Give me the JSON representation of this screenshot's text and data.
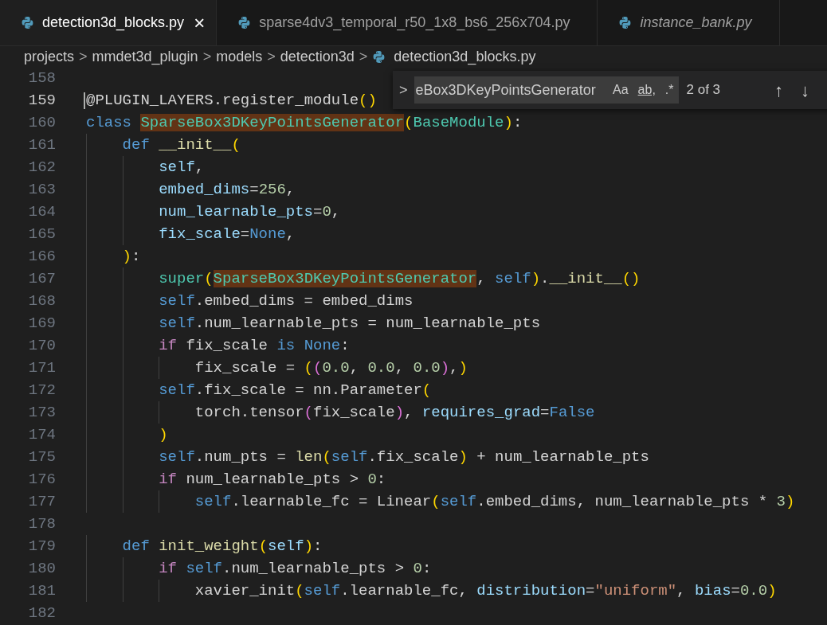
{
  "tabs": [
    {
      "label": "detection3d_blocks.py",
      "selected": true,
      "preview": false,
      "close": "×"
    },
    {
      "label": "sparse4dv3_temporal_r50_1x8_bs6_256x704.py",
      "selected": false,
      "preview": false
    },
    {
      "label": "instance_bank.py",
      "selected": false,
      "preview": true
    }
  ],
  "breadcrumb": [
    {
      "label": "projects",
      "kind": "folder"
    },
    {
      "label": "mmdet3d_plugin",
      "kind": "folder"
    },
    {
      "label": "models",
      "kind": "folder"
    },
    {
      "label": "detection3d",
      "kind": "folder"
    },
    {
      "label": "detection3d_blocks.py",
      "kind": "file"
    }
  ],
  "breadcrumb_separator": ">",
  "find_widget": {
    "toggle": ">",
    "query": "eBox3DKeyPointsGenerator",
    "options": [
      "Aa",
      "ab,",
      ".*"
    ],
    "result": "2 of 3",
    "previous": "↑",
    "next": "↓"
  },
  "lines": [
    {
      "number": "158",
      "current": false
    },
    {
      "number": "159",
      "current": true,
      "tokens": [
        {
          "text": "@PLUGIN_LAYERS.register_module",
          "kind": "plain"
        },
        {
          "text": "()",
          "kind": "bracket1"
        }
      ]
    },
    {
      "number": "160",
      "current": false,
      "tokens": [
        {
          "text": "class ",
          "kind": "keyword"
        },
        {
          "text": "SparseBox3DKeyPointsGenerator",
          "kind": "class",
          "match": true
        },
        {
          "text": "(",
          "kind": "bracket1"
        },
        {
          "text": "BaseModule",
          "kind": "class"
        },
        {
          "text": ")",
          "kind": "bracket1"
        },
        {
          "text": ":",
          "kind": "plain"
        }
      ]
    },
    {
      "number": "161",
      "current": false,
      "tokens": [
        {
          "text": "    def ",
          "kind": "keyword"
        },
        {
          "text": "__init__",
          "kind": "function"
        },
        {
          "text": "(",
          "kind": "bracket1"
        }
      ]
    },
    {
      "number": "162",
      "current": false,
      "tokens": [
        {
          "text": "        self",
          "kind": "variable"
        },
        {
          "text": ",",
          "kind": "plain"
        }
      ]
    },
    {
      "number": "163",
      "current": false,
      "tokens": [
        {
          "text": "        embed_dims",
          "kind": "variable"
        },
        {
          "text": "=",
          "kind": "plain"
        },
        {
          "text": "256",
          "kind": "number"
        },
        {
          "text": ",",
          "kind": "plain"
        }
      ]
    },
    {
      "number": "164",
      "current": false,
      "tokens": [
        {
          "text": "        num_learnable_pts",
          "kind": "variable"
        },
        {
          "text": "=",
          "kind": "plain"
        },
        {
          "text": "0",
          "kind": "number"
        },
        {
          "text": ",",
          "kind": "plain"
        }
      ]
    },
    {
      "number": "165",
      "current": false,
      "tokens": [
        {
          "text": "        fix_scale",
          "kind": "variable"
        },
        {
          "text": "=",
          "kind": "plain"
        },
        {
          "text": "None",
          "kind": "keyword"
        },
        {
          "text": ",",
          "kind": "plain"
        }
      ]
    },
    {
      "number": "166",
      "current": false,
      "tokens": [
        {
          "text": "    )",
          "kind": "bracket1"
        },
        {
          "text": ":",
          "kind": "plain"
        }
      ]
    },
    {
      "number": "167",
      "current": false,
      "tokens": [
        {
          "text": "        super",
          "kind": "class"
        },
        {
          "text": "(",
          "kind": "bracket1"
        },
        {
          "text": "SparseBox3DKeyPointsGenerator",
          "kind": "class",
          "match": true
        },
        {
          "text": ", ",
          "kind": "plain"
        },
        {
          "text": "self",
          "kind": "keyword"
        },
        {
          "text": ")",
          "kind": "bracket1"
        },
        {
          "text": ".",
          "kind": "plain"
        },
        {
          "text": "__init__",
          "kind": "function"
        },
        {
          "text": "()",
          "kind": "bracket1"
        }
      ]
    },
    {
      "number": "168",
      "current": false,
      "tokens": [
        {
          "text": "        self",
          "kind": "keyword"
        },
        {
          "text": ".embed_dims = embed_dims",
          "kind": "plain"
        }
      ]
    },
    {
      "number": "169",
      "current": false,
      "tokens": [
        {
          "text": "        self",
          "kind": "keyword"
        },
        {
          "text": ".num_learnable_pts = num_learnable_pts",
          "kind": "plain"
        }
      ]
    },
    {
      "number": "170",
      "current": false,
      "tokens": [
        {
          "text": "        if",
          "kind": "control"
        },
        {
          "text": " fix_scale ",
          "kind": "plain"
        },
        {
          "text": "is None",
          "kind": "keyword"
        },
        {
          "text": ":",
          "kind": "plain"
        }
      ]
    },
    {
      "number": "171",
      "current": false,
      "tokens": [
        {
          "text": "            fix_scale = ",
          "kind": "plain"
        },
        {
          "text": "(",
          "kind": "bracket1"
        },
        {
          "text": "(",
          "kind": "bracket2"
        },
        {
          "text": "0.0",
          "kind": "number"
        },
        {
          "text": ", ",
          "kind": "plain"
        },
        {
          "text": "0.0",
          "kind": "number"
        },
        {
          "text": ", ",
          "kind": "plain"
        },
        {
          "text": "0.0",
          "kind": "number"
        },
        {
          "text": ")",
          "kind": "bracket2"
        },
        {
          "text": ",",
          "kind": "plain"
        },
        {
          "text": ")",
          "kind": "bracket1"
        }
      ]
    },
    {
      "number": "172",
      "current": false,
      "tokens": [
        {
          "text": "        self",
          "kind": "keyword"
        },
        {
          "text": ".fix_scale = nn.Parameter",
          "kind": "plain"
        },
        {
          "text": "(",
          "kind": "bracket1"
        }
      ]
    },
    {
      "number": "173",
      "current": false,
      "tokens": [
        {
          "text": "            torch.tensor",
          "kind": "plain"
        },
        {
          "text": "(",
          "kind": "bracket2"
        },
        {
          "text": "fix_scale",
          "kind": "plain"
        },
        {
          "text": ")",
          "kind": "bracket2"
        },
        {
          "text": ", ",
          "kind": "plain"
        },
        {
          "text": "requires_grad",
          "kind": "variable"
        },
        {
          "text": "=",
          "kind": "plain"
        },
        {
          "text": "False",
          "kind": "keyword"
        }
      ]
    },
    {
      "number": "174",
      "current": false,
      "tokens": [
        {
          "text": "        )",
          "kind": "bracket1"
        }
      ]
    },
    {
      "number": "175",
      "current": false,
      "tokens": [
        {
          "text": "        self",
          "kind": "keyword"
        },
        {
          "text": ".num_pts = ",
          "kind": "plain"
        },
        {
          "text": "len",
          "kind": "function"
        },
        {
          "text": "(",
          "kind": "bracket1"
        },
        {
          "text": "self",
          "kind": "keyword"
        },
        {
          "text": ".fix_scale",
          "kind": "plain"
        },
        {
          "text": ")",
          "kind": "bracket1"
        },
        {
          "text": " + num_learnable_pts",
          "kind": "plain"
        }
      ]
    },
    {
      "number": "176",
      "current": false,
      "tokens": [
        {
          "text": "        if",
          "kind": "control"
        },
        {
          "text": " num_learnable_pts > ",
          "kind": "plain"
        },
        {
          "text": "0",
          "kind": "number"
        },
        {
          "text": ":",
          "kind": "plain"
        }
      ]
    },
    {
      "number": "177",
      "current": false,
      "tokens": [
        {
          "text": "            self",
          "kind": "keyword"
        },
        {
          "text": ".learnable_fc = Linear",
          "kind": "plain"
        },
        {
          "text": "(",
          "kind": "bracket1"
        },
        {
          "text": "self",
          "kind": "keyword"
        },
        {
          "text": ".embed_dims, num_learnable_pts * ",
          "kind": "plain"
        },
        {
          "text": "3",
          "kind": "number"
        },
        {
          "text": ")",
          "kind": "bracket1"
        }
      ]
    },
    {
      "number": "178",
      "current": false
    },
    {
      "number": "179",
      "current": false,
      "tokens": [
        {
          "text": "    def ",
          "kind": "keyword"
        },
        {
          "text": "init_weight",
          "kind": "function"
        },
        {
          "text": "(",
          "kind": "bracket1"
        },
        {
          "text": "self",
          "kind": "variable"
        },
        {
          "text": ")",
          "kind": "bracket1"
        },
        {
          "text": ":",
          "kind": "plain"
        }
      ]
    },
    {
      "number": "180",
      "current": false,
      "tokens": [
        {
          "text": "        if ",
          "kind": "control"
        },
        {
          "text": "self",
          "kind": "keyword"
        },
        {
          "text": ".num_learnable_pts > ",
          "kind": "plain"
        },
        {
          "text": "0",
          "kind": "number"
        },
        {
          "text": ":",
          "kind": "plain"
        }
      ]
    },
    {
      "number": "181",
      "current": false,
      "tokens": [
        {
          "text": "            xavier_init",
          "kind": "plain"
        },
        {
          "text": "(",
          "kind": "bracket1"
        },
        {
          "text": "self",
          "kind": "keyword"
        },
        {
          "text": ".learnable_fc, ",
          "kind": "plain"
        },
        {
          "text": "distribution",
          "kind": "variable"
        },
        {
          "text": "=",
          "kind": "plain"
        },
        {
          "text": "\"uniform\"",
          "kind": "string"
        },
        {
          "text": ", ",
          "kind": "plain"
        },
        {
          "text": "bias",
          "kind": "variable"
        },
        {
          "text": "=",
          "kind": "plain"
        },
        {
          "text": "0.0",
          "kind": "number"
        },
        {
          "text": ")",
          "kind": "bracket1"
        }
      ]
    },
    {
      "number": "182",
      "current": false
    }
  ]
}
